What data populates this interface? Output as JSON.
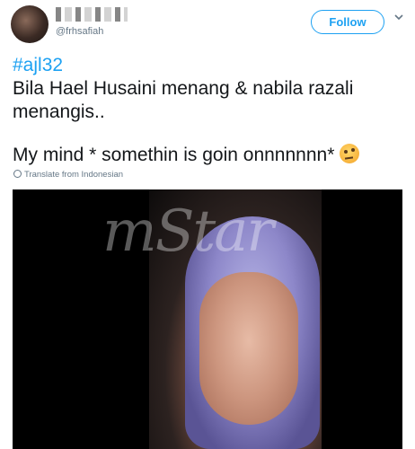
{
  "header": {
    "handle": "@frhsafiah",
    "follow_label": "Follow",
    "menu_icon": "chevron-down-icon"
  },
  "tweet": {
    "hashtag": "#ajl32",
    "line1": "Bila Hael Husaini menang & nabila razali",
    "line2": "menangis..",
    "line3": "My mind * somethin is goin onnnnnnn*",
    "emoji": "thinking-face-emoji"
  },
  "translate": {
    "label": "Translate from Indonesian",
    "icon": "globe-icon"
  },
  "media": {
    "watermark": "mStar",
    "alt": ""
  },
  "colors": {
    "accent": "#1da1f2",
    "text": "#14171a",
    "muted": "#657786"
  }
}
